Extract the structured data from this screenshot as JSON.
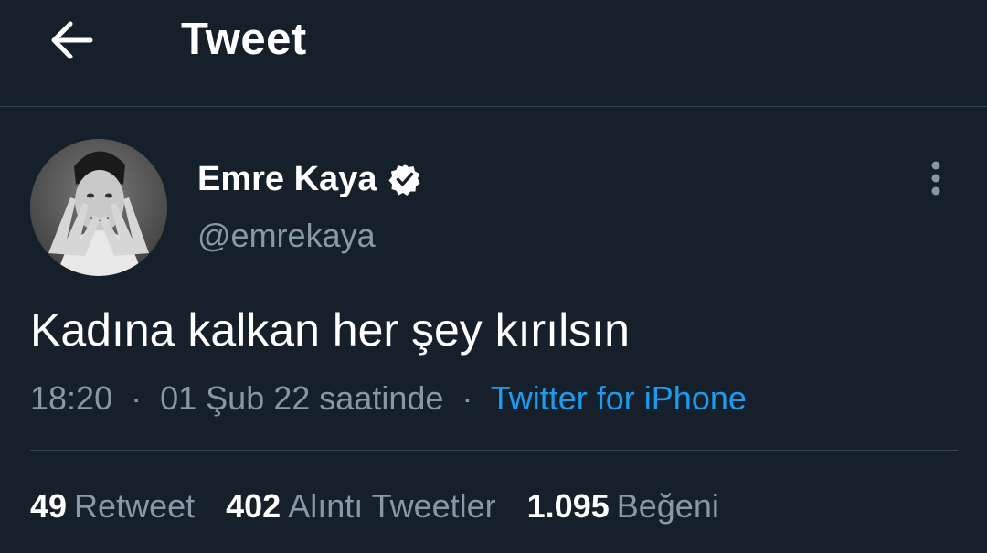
{
  "header": {
    "title": "Tweet",
    "back_icon": "arrow-left-icon"
  },
  "author": {
    "display_name": "Emre Kaya",
    "handle": "@emrekaya",
    "verified": true,
    "verified_icon": "verified-badge-icon"
  },
  "more_icon": "more-vertical-icon",
  "tweet": {
    "text": "Kadına kalkan her şey kırılsın",
    "time": "18:20",
    "separator": "·",
    "date": "01 Şub 22 saatinde",
    "source": "Twitter for iPhone"
  },
  "stats": [
    {
      "count": "49",
      "label": "Retweet"
    },
    {
      "count": "402",
      "label": "Alıntı Tweetler"
    },
    {
      "count": "1.095",
      "label": "Beğeni"
    }
  ],
  "colors": {
    "background": "#15202b",
    "accent": "#1d9bf0",
    "secondary_text": "#8899a6",
    "border": "#38444d"
  }
}
